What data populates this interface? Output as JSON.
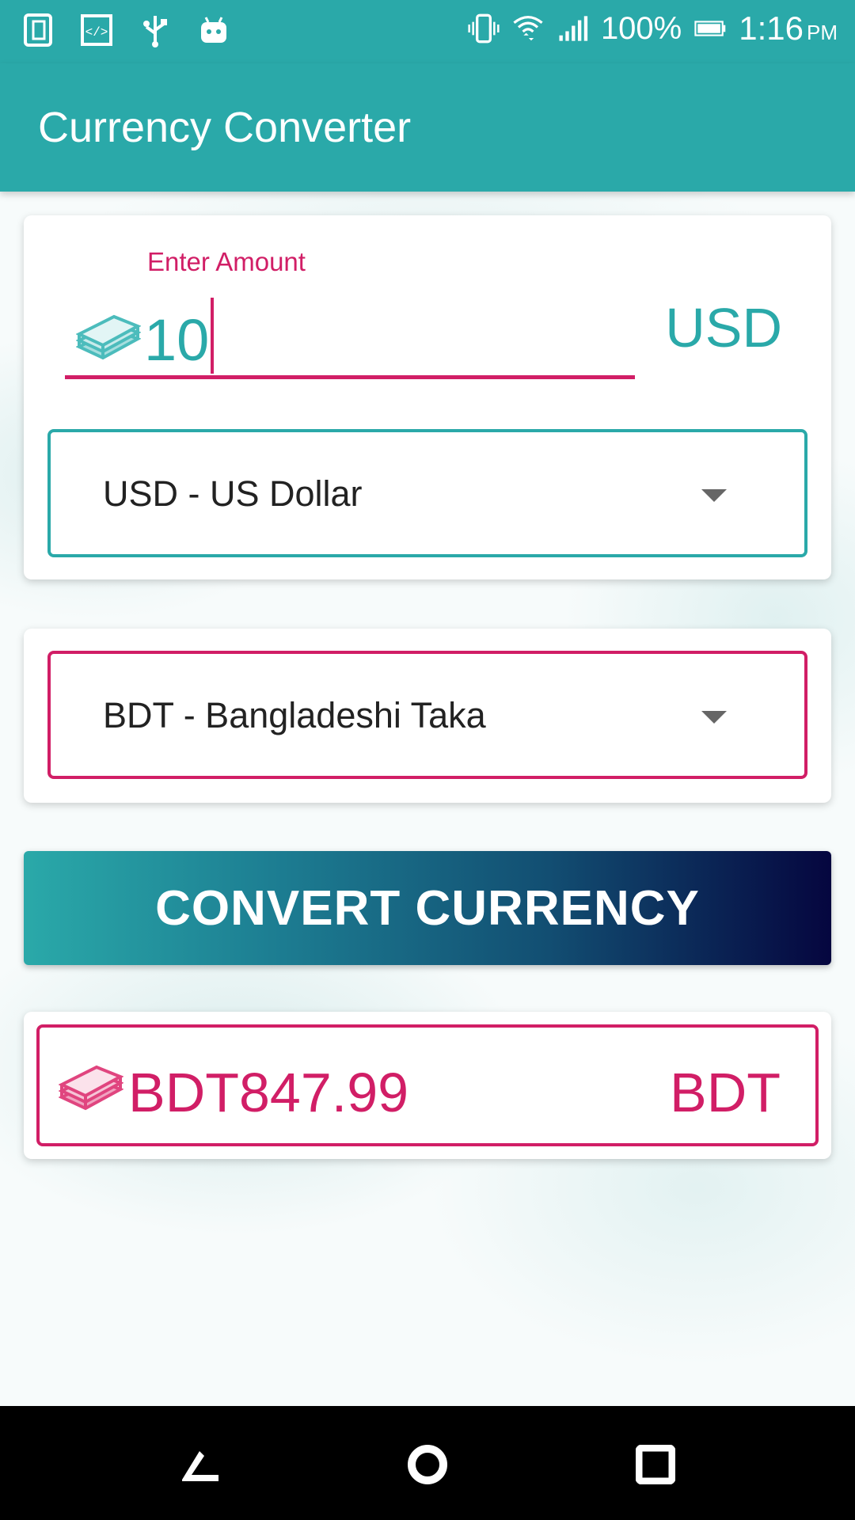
{
  "status_bar": {
    "battery_text": "100%",
    "time": "1:16",
    "ampm": "PM"
  },
  "app": {
    "title": "Currency Converter"
  },
  "amount": {
    "label": "Enter Amount",
    "value": "10",
    "currency_code": "USD"
  },
  "from_select": {
    "selected": "USD - US Dollar"
  },
  "to_select": {
    "selected": "BDT - Bangladeshi Taka"
  },
  "convert_button": {
    "label": "CONVERT CURRENCY"
  },
  "result": {
    "value": "BDT847.99",
    "currency_code": "BDT"
  },
  "colors": {
    "primary": "#2aa9a9",
    "accent": "#d11e66",
    "gradient_end": "#05063f"
  },
  "icons": [
    "sim-icon",
    "code-icon",
    "usb-icon",
    "android-icon",
    "vibrate-icon",
    "wifi-icon",
    "signal-icon",
    "battery-icon",
    "money-icon",
    "back-icon",
    "home-icon",
    "recents-icon"
  ]
}
